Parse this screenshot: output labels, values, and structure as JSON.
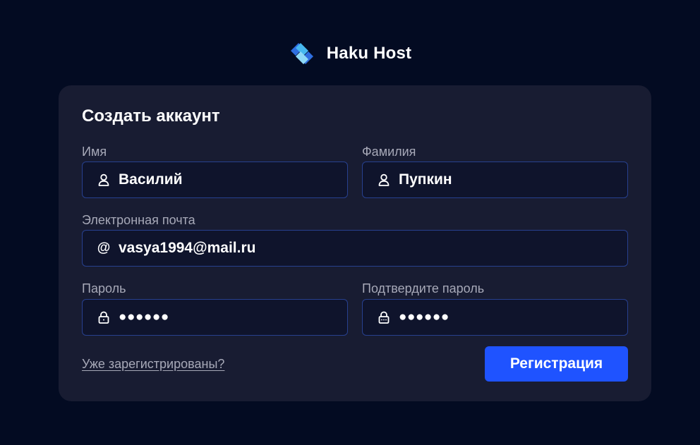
{
  "brand": {
    "name": "Haku Host",
    "logo_icon": "haku-host-logo"
  },
  "colors": {
    "background": "#030b22",
    "card": "#181c32",
    "field_background": "#0f142c",
    "field_border": "#27408f",
    "accent": "#1f53ff",
    "label": "#a7a9b8",
    "text": "#ffffff"
  },
  "form": {
    "title": "Создать аккаунт",
    "first_name": {
      "label": "Имя",
      "value": "Василий",
      "icon": "user-icon"
    },
    "last_name": {
      "label": "Фамилия",
      "value": "Пупкин",
      "icon": "user-icon"
    },
    "email": {
      "label": "Электронная почта",
      "value": "vasya1994@mail.ru",
      "icon": "at-icon",
      "icon_glyph": "@"
    },
    "password": {
      "label": "Пароль",
      "value": "●●●●●●",
      "icon": "lock-icon"
    },
    "confirm_password": {
      "label": "Подтвердите пароль",
      "value": "●●●●●●",
      "icon": "lock-dots-icon"
    },
    "login_link": "Уже зарегистрированы?",
    "submit_label": "Регистрация"
  }
}
